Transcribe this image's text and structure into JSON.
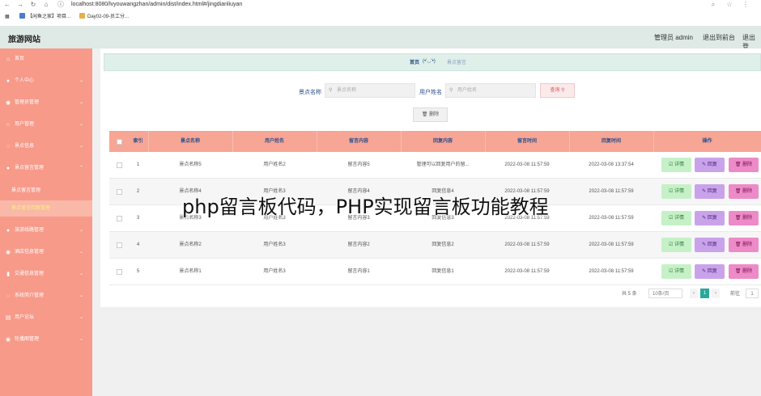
{
  "browser": {
    "url": "localhost:8080/lvyouwangzhan/admin/dist/index.html#/jingdianliuyan",
    "bookmarks": [
      "【闲鱼之家】项目...",
      "Day02-09-员工分..."
    ]
  },
  "header": {
    "logo": "旅游网站",
    "admin_label": "管理员 admin",
    "to_front": "退出到前台",
    "logout": "退出登"
  },
  "sidebar": {
    "items": [
      {
        "label": "首页",
        "icon": "home-icon",
        "chev": false
      },
      {
        "label": "个人中心",
        "icon": "user-icon",
        "chev": true
      },
      {
        "label": "管理员管理",
        "icon": "admin-icon",
        "chev": true
      },
      {
        "label": "用户管理",
        "icon": "users-icon",
        "chev": true
      },
      {
        "label": "景点信息",
        "icon": "location-icon",
        "chev": true
      },
      {
        "label": "景点留言管理",
        "icon": "message-icon",
        "chev": true
      }
    ],
    "subitems": [
      "景点留言管理",
      "景点留言回复管理"
    ],
    "items2": [
      {
        "label": "旅游线路管理",
        "icon": "route-icon"
      },
      {
        "label": "酒店信息管理",
        "icon": "hotel-icon"
      },
      {
        "label": "交通信息管理",
        "icon": "chart-icon"
      },
      {
        "label": "系统简介管理",
        "icon": "info-icon"
      },
      {
        "label": "用户论坛",
        "icon": "forum-icon"
      },
      {
        "label": "轮播图管理",
        "icon": "image-icon"
      }
    ]
  },
  "breadcrumb": {
    "home": "首页",
    "face": "(•'◡'•)",
    "current": "景点留言"
  },
  "filters": {
    "scenic_label": "景点名称",
    "scenic_placeholder": "景点名称",
    "user_label": "用户姓名",
    "user_placeholder": "用户姓名",
    "search_button": "查询",
    "delete_button": "删除"
  },
  "table": {
    "headers": [
      "索引",
      "景点名称",
      "用户姓名",
      "留言内容",
      "回复内容",
      "留言时间",
      "回复时间",
      "操作"
    ],
    "rows": [
      {
        "index": "1",
        "scenic": "景点名称5",
        "user": "用户姓名2",
        "content": "留言内容5",
        "reply": "管理可以回复用户的留...",
        "time": "2022-03-08 11:57:59",
        "reply_time": "2022-03-08 13:37:54"
      },
      {
        "index": "2",
        "scenic": "景点名称4",
        "user": "用户姓名3",
        "content": "留言内容4",
        "reply": "回复信息4",
        "time": "2022-03-08 11:57:59",
        "reply_time": "2022-03-08 11:57:59"
      },
      {
        "index": "3",
        "scenic": "景点名称3",
        "user": "用户姓名3",
        "content": "留言内容3",
        "reply": "回复信息3",
        "time": "2022-03-08 11:57:59",
        "reply_time": "2022-03-08 11:57:59"
      },
      {
        "index": "4",
        "scenic": "景点名称2",
        "user": "用户姓名3",
        "content": "留言内容2",
        "reply": "回复信息2",
        "time": "2022-03-08 11:57:59",
        "reply_time": "2022-03-08 11:57:59"
      },
      {
        "index": "5",
        "scenic": "景点名称1",
        "user": "用户姓名3",
        "content": "留言内容1",
        "reply": "回复信息1",
        "time": "2022-03-08 11:57:59",
        "reply_time": "2022-03-08 11:57:59"
      }
    ],
    "actions": {
      "detail": "详情",
      "reply": "回复",
      "delete": "删除"
    }
  },
  "pagination": {
    "total": "共 5 条",
    "page_size": "10条/页",
    "current": "1",
    "goto_label": "前往",
    "goto_value": "1"
  },
  "overlay_text": "php留言板代码，PHP实现留言板功能教程",
  "colors": {
    "sidebar": "#f79a8a",
    "header": "#dfe9e6",
    "table_header": "#f7a595",
    "detail": "#c6f1c8",
    "reply": "#c9a3ea",
    "delete": "#ec8bc7"
  }
}
